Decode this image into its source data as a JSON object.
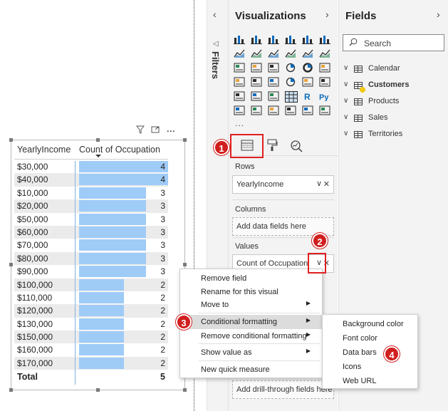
{
  "matrix": {
    "col1_header": "YearlyIncome",
    "col2_header": "Count of Occupation",
    "max_value": 4,
    "rows": [
      {
        "label": "$30,000",
        "value": 4
      },
      {
        "label": "$40,000",
        "value": 4
      },
      {
        "label": "$10,000",
        "value": 3
      },
      {
        "label": "$20,000",
        "value": 3
      },
      {
        "label": "$50,000",
        "value": 3
      },
      {
        "label": "$60,000",
        "value": 3
      },
      {
        "label": "$70,000",
        "value": 3
      },
      {
        "label": "$80,000",
        "value": 3
      },
      {
        "label": "$90,000",
        "value": 3
      },
      {
        "label": "$100,000",
        "value": 2
      },
      {
        "label": "$110,000",
        "value": 2
      },
      {
        "label": "$120,000",
        "value": 2
      },
      {
        "label": "$130,000",
        "value": 2
      },
      {
        "label": "$150,000",
        "value": 2
      },
      {
        "label": "$160,000",
        "value": 2
      },
      {
        "label": "$170,000",
        "value": 2
      }
    ],
    "total_label": "Total",
    "total_value": "5",
    "bar_color": "#9fcbf7"
  },
  "visual_header_icons": [
    "filter-icon",
    "focus-mode-icon",
    "more-options-icon"
  ],
  "filters_pane": {
    "title": "Filters"
  },
  "viz_pane": {
    "title": "Visualizations",
    "more_label": "...",
    "tabs": [
      "fields-tab-icon",
      "format-tab-icon",
      "analytics-tab-icon"
    ],
    "rows_label": "Rows",
    "rows_field": "YearlyIncome",
    "columns_label": "Columns",
    "columns_placeholder": "Add data fields here",
    "values_label": "Values",
    "values_field": "Count of Occupation",
    "drillthrough_placeholder": "Add drill-through fields here"
  },
  "fields_pane": {
    "title": "Fields",
    "search_placeholder": "Search",
    "tables": [
      {
        "name": "Calendar",
        "bold": false
      },
      {
        "name": "Customers",
        "bold": true
      },
      {
        "name": "Products",
        "bold": false
      },
      {
        "name": "Sales",
        "bold": false
      },
      {
        "name": "Territories",
        "bold": false
      }
    ]
  },
  "context_menu": {
    "items": [
      {
        "label": "Remove field",
        "arrow": false
      },
      {
        "label": "Rename for this visual",
        "arrow": false
      },
      {
        "label": "Move to",
        "arrow": true
      },
      {
        "label": "Conditional formatting",
        "arrow": true,
        "highlight": true
      },
      {
        "label": "Remove conditional formatting",
        "arrow": true
      },
      {
        "label": "Show value as",
        "arrow": true
      },
      {
        "label": "New quick measure",
        "arrow": false
      }
    ]
  },
  "submenu": {
    "items": [
      "Background color",
      "Font color",
      "Data bars",
      "Icons",
      "Web URL"
    ]
  },
  "markers": [
    "1",
    "2",
    "3",
    "4"
  ],
  "accent_red": "#d11e1e"
}
